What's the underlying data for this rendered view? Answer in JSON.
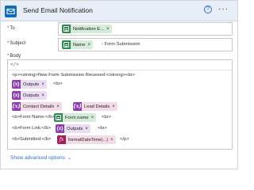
{
  "header": {
    "title": "Send Email Notification",
    "help_glyph": "?",
    "more_glyph": "···",
    "icon": "outlook-icon"
  },
  "to": {
    "label": "To",
    "token": "Notification E...",
    "token_icon": "excel-icon"
  },
  "subject": {
    "label": "Subject",
    "token": "Name",
    "token_icon": "excel-icon",
    "suffix": "- Form Submission"
  },
  "body": {
    "label": "Body",
    "code_glyph": "</>",
    "lines": {
      "l1": "<p><strong>New Form Submission Received:</strong><br>",
      "l2_token": "Outputs",
      "l2_after": "<br>",
      "l3_token": "Outputs",
      "l4_token_a": "Contact Details",
      "l4_token_b": "Lead Details",
      "l5_before": "<b>Form Name:</b>",
      "l5_token": "Form name",
      "l5_after": "<br>",
      "l6_before": "<b>Form Link:</b>",
      "l6_token": "Outputs",
      "l6_after": "<br>",
      "l7_before": "<b>Submitted:</b>",
      "l7_token": "formatDateTime(...)",
      "l7_after": "</p>"
    }
  },
  "advanced": {
    "label": "Show advanced options",
    "chevron": "⌄"
  },
  "close_glyph": "×",
  "fx_glyph": "fx",
  "var_glyph": "{x}",
  "colors": {
    "excel": "#2c8a4a",
    "variable": "#8c3fb0",
    "expression": "#a31f5c",
    "link": "#2a6fdb",
    "required": "#d13438"
  }
}
